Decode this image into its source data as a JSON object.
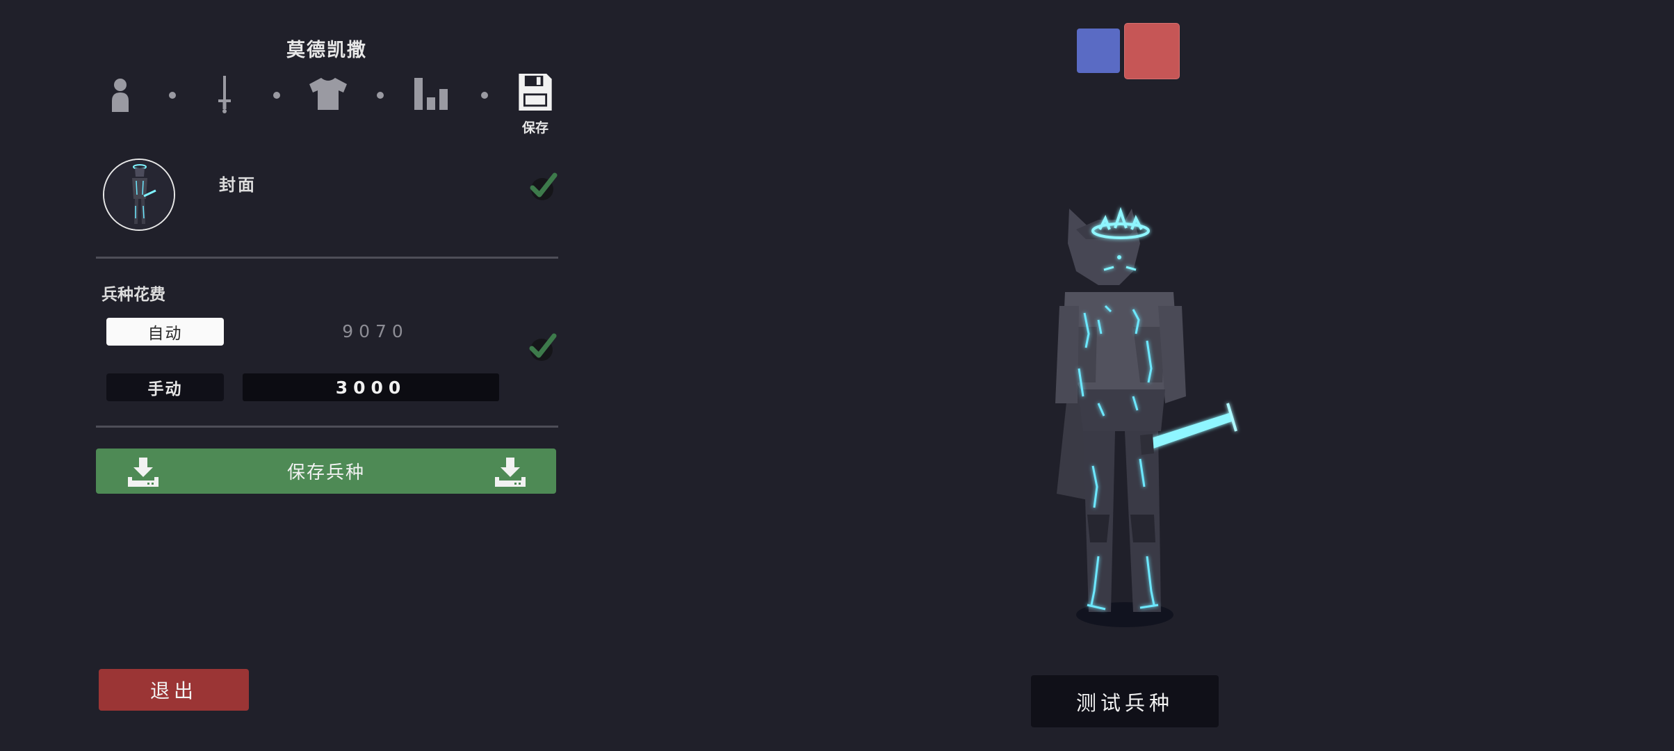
{
  "editor": {
    "unit_name": "莫德凯撒",
    "steps": [
      {
        "icon": "person-icon"
      },
      {
        "icon": "sword-icon"
      },
      {
        "icon": "shirt-icon"
      },
      {
        "icon": "bar-chart-icon"
      },
      {
        "icon": "floppy-disk-icon",
        "label": "保存"
      }
    ],
    "cover": {
      "label": "封面",
      "checked": true
    },
    "cost": {
      "section_label": "兵种花费",
      "auto_label": "自动",
      "auto_value": "9070",
      "manual_label": "手动",
      "manual_value": "3000",
      "checked": true
    },
    "save_button_label": "保存兵种",
    "exit_button_label": "退出"
  },
  "preview": {
    "team_colors": [
      "#5a6bc4",
      "#c65656"
    ],
    "test_button_label": "测试兵种"
  }
}
